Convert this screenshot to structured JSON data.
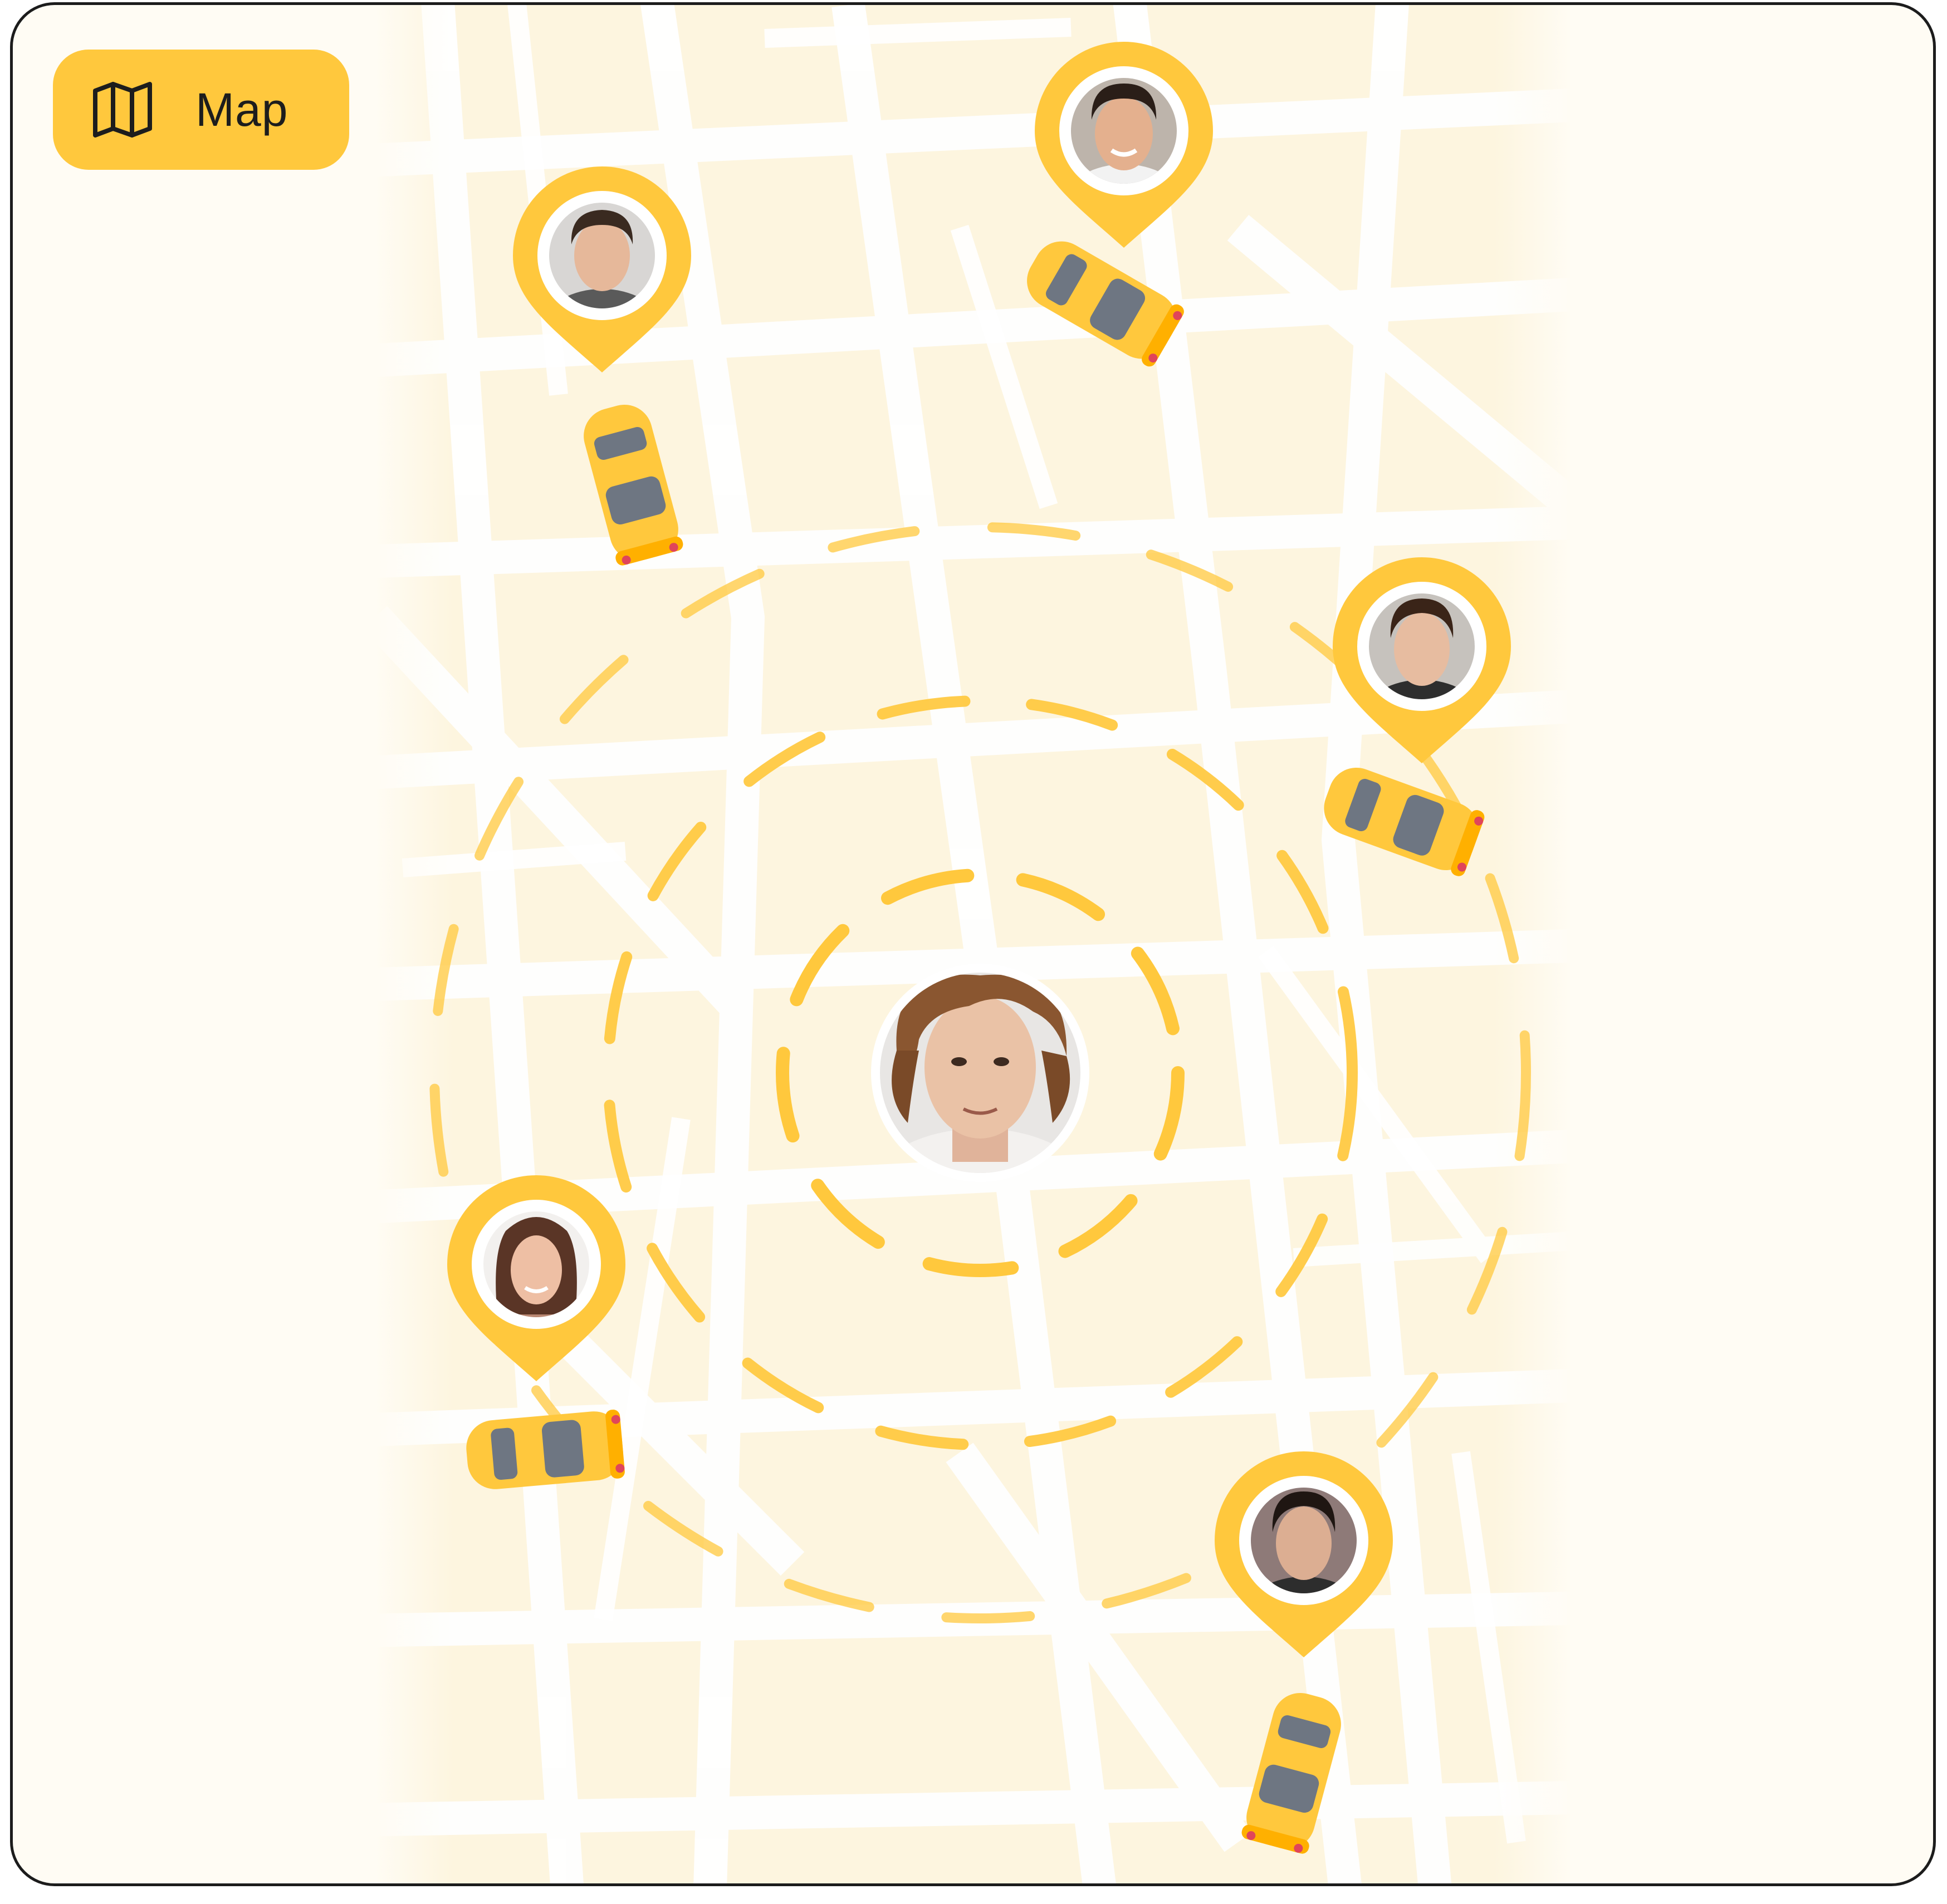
{
  "header": {
    "map_button_label": "Map",
    "map_button_icon": "map-icon"
  },
  "colors": {
    "accent": "#ffc83d",
    "accent_dark": "#f5b400",
    "ring": "#ffc83d",
    "background": "#fffcf4",
    "block": "#fdf4dc",
    "road": "#ffffff"
  },
  "user": {
    "avatar_icon": "user-avatar"
  },
  "drivers": [
    {
      "id": 1,
      "pin_icon": "driver-pin-icon",
      "car_icon": "taxi-car-icon",
      "car_heading_deg": 165
    },
    {
      "id": 2,
      "pin_icon": "driver-pin-icon",
      "car_icon": "taxi-car-icon",
      "car_heading_deg": 120
    },
    {
      "id": 3,
      "pin_icon": "driver-pin-icon",
      "car_icon": "taxi-car-icon",
      "car_heading_deg": 110
    },
    {
      "id": 4,
      "pin_icon": "driver-pin-icon",
      "car_icon": "taxi-car-icon",
      "car_heading_deg": 85
    },
    {
      "id": 5,
      "pin_icon": "driver-pin-icon",
      "car_icon": "taxi-car-icon",
      "car_heading_deg": 195
    }
  ]
}
